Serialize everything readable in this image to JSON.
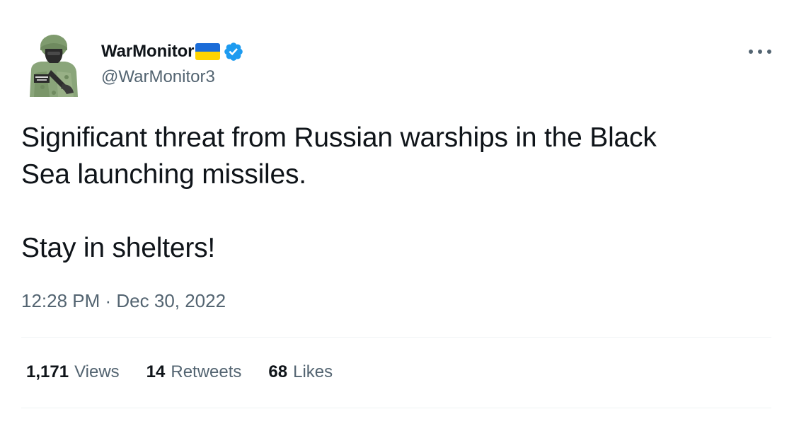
{
  "author": {
    "display_name": "WarMonitor",
    "handle": "@WarMonitor3",
    "verified": true,
    "flag": "ukraine-flag",
    "avatar_icon": "soldier-avatar"
  },
  "tweet": {
    "text": "Significant threat from Russian warships in the Black\nSea launching missiles.\n\nStay in shelters!",
    "timestamp": "12:28 PM · Dec 30, 2022"
  },
  "stats": {
    "views_count": "1,171",
    "views_label": "Views",
    "retweets_count": "14",
    "retweets_label": "Retweets",
    "likes_count": "68",
    "likes_label": "Likes"
  },
  "colors": {
    "text_primary": "#0f1419",
    "text_secondary": "#536471",
    "verified_blue": "#1d9bf0",
    "divider": "#eff3f4",
    "flag_blue": "#1b6cd8",
    "flag_yellow": "#ffd400"
  }
}
